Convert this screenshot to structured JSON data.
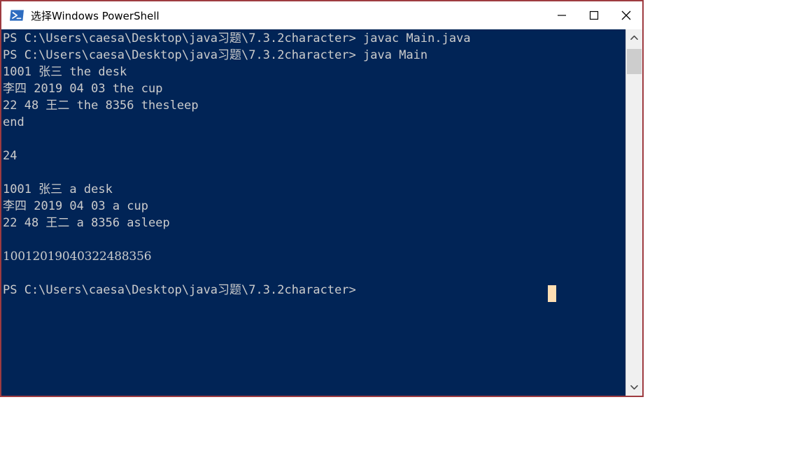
{
  "window": {
    "title": "选择Windows PowerShell",
    "icon": "powershell-icon",
    "border_color": "#9e3b40",
    "titlebar_bg": "#ffffff",
    "controls": {
      "minimize": "minimize-icon",
      "maximize": "maximize-icon",
      "close": "close-icon"
    }
  },
  "console": {
    "bg_color": "#012456",
    "fg_color": "#cccccc",
    "cursor_color": "#ffdeb3",
    "lines": [
      "PS C:\\Users\\caesa\\Desktop\\java习题\\7.3.2character> javac Main.java",
      "PS C:\\Users\\caesa\\Desktop\\java习题\\7.3.2character> java Main",
      "1001 张三 the desk",
      "李四 2019 04 03 the cup",
      "22 48 王二 the 8356 thesleep",
      "end",
      "",
      "24",
      "",
      "1001 张三 a desk",
      "李四 2019 04 03 a cup",
      "22 48 王二 a 8356 asleep",
      "",
      "10012019040322488356",
      "",
      "PS C:\\Users\\caesa\\Desktop\\java习题\\7.3.2character>"
    ],
    "narrow_font_line_index": 13
  },
  "scrollbar": {
    "up_arrow": "chevron-up-icon",
    "down_arrow": "chevron-down-icon",
    "thumb": "scrollbar-thumb"
  }
}
